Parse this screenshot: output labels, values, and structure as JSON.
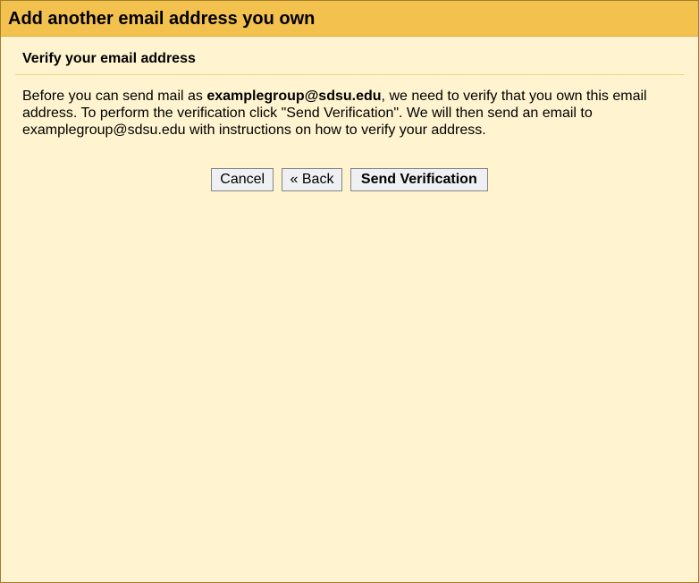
{
  "dialog": {
    "title": "Add another email address you own",
    "subtitle": "Verify your email address",
    "description_before": "Before you can send mail as ",
    "description_email": "examplegroup@sdsu.edu",
    "description_after": ", we need to verify that you own this email address. To perform the verification click \"Send Verification\". We will then send an email to examplegroup@sdsu.edu with instructions on how to verify your address.",
    "buttons": {
      "cancel": "Cancel",
      "back": "« Back",
      "send": "Send Verification"
    }
  }
}
